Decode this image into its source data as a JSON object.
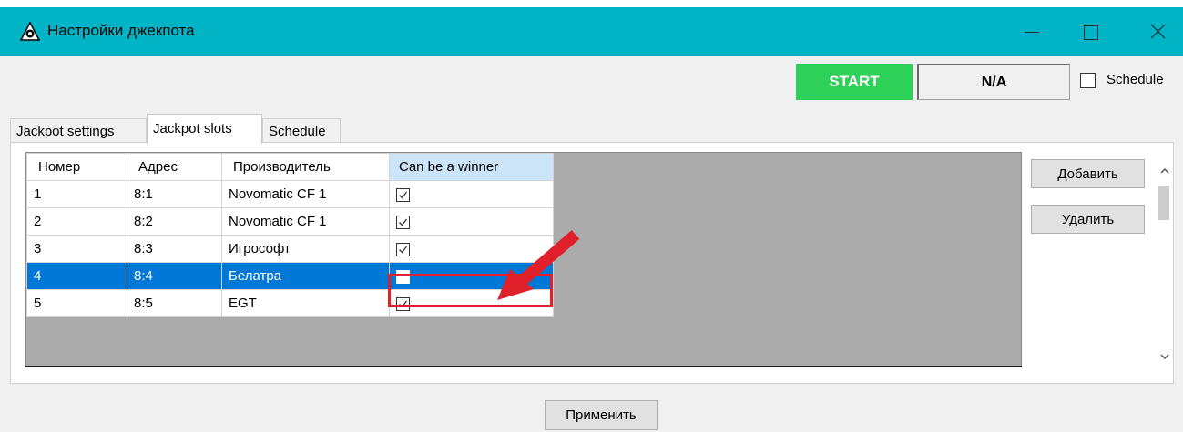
{
  "window": {
    "title": "Настройки джекпота",
    "accent_color": "#00b4c6"
  },
  "toolbar": {
    "start_label": "START",
    "start_color": "#2ed157",
    "status_value": "N/A",
    "schedule_label": "Schedule",
    "schedule_checked": false
  },
  "tabs": [
    {
      "label": "Jackpot settings",
      "active": false
    },
    {
      "label": "Jackpot slots",
      "active": true
    },
    {
      "label": "Schedule",
      "active": false
    }
  ],
  "grid": {
    "columns": [
      "Номер",
      "Адрес",
      "Производитель",
      "Can be a winner"
    ],
    "rows": [
      {
        "number": "1",
        "address": "8:1",
        "manufacturer": "Novomatic CF 1",
        "can_win": true,
        "selected": false
      },
      {
        "number": "2",
        "address": "8:2",
        "manufacturer": "Novomatic CF 1",
        "can_win": true,
        "selected": false
      },
      {
        "number": "3",
        "address": "8:3",
        "manufacturer": "Игрософт",
        "can_win": true,
        "selected": false
      },
      {
        "number": "4",
        "address": "8:4",
        "manufacturer": "Белатра",
        "can_win": false,
        "selected": true
      },
      {
        "number": "5",
        "address": "8:5",
        "manufacturer": "EGT",
        "can_win": true,
        "selected": false
      }
    ]
  },
  "side_buttons": {
    "add_label": "Добавить",
    "delete_label": "Удалить"
  },
  "footer": {
    "apply_label": "Применить"
  },
  "annotation": {
    "arrow_color": "#e0202a"
  }
}
